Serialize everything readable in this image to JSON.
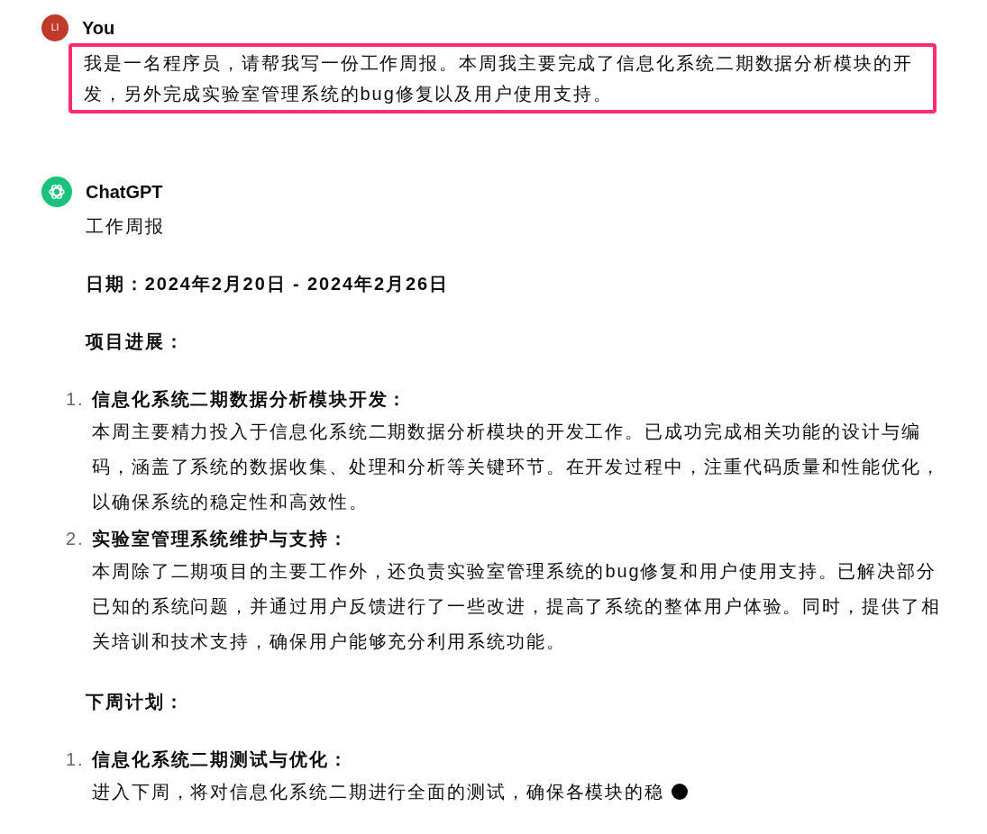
{
  "user": {
    "avatar": "LI",
    "name": "You",
    "message": "我是一名程序员，请帮我写一份工作周报。本周我主要完成了信息化系统二期数据分析模块的开发，另外完成实验室管理系统的bug修复以及用户使用支持。",
    "highlighted": true
  },
  "assistant": {
    "name": "ChatGPT",
    "streaming": true,
    "blocks": [
      {
        "kind": "plain",
        "text": "工作周报"
      },
      {
        "kind": "bold",
        "text": "日期：2024年2月20日 - 2024年2月26日"
      },
      {
        "kind": "bold",
        "text": "项目进展："
      },
      {
        "kind": "list",
        "items": [
          {
            "number": "1.",
            "title": "信息化系统二期数据分析模块开发：",
            "body": "本周主要精力投入于信息化系统二期数据分析模块的开发工作。已成功完成相关功能的设计与编码，涵盖了系统的数据收集、处理和分析等关键环节。在开发过程中，注重代码质量和性能优化，以确保系统的稳定性和高效性。"
          },
          {
            "number": "2.",
            "title": "实验室管理系统维护与支持：",
            "body": "本周除了二期项目的主要工作外，还负责实验室管理系统的bug修复和用户使用支持。已解决部分已知的系统问题，并通过用户反馈进行了一些改进，提高了系统的整体用户体验。同时，提供了相关培训和技术支持，确保用户能够充分利用系统功能。"
          }
        ]
      },
      {
        "kind": "bold",
        "text": "下周计划："
      },
      {
        "kind": "list",
        "items": [
          {
            "number": "1.",
            "title": "信息化系统二期测试与优化：",
            "body": "进入下周，将对信息化系统二期进行全面的测试，确保各模块的稳"
          }
        ]
      }
    ]
  }
}
